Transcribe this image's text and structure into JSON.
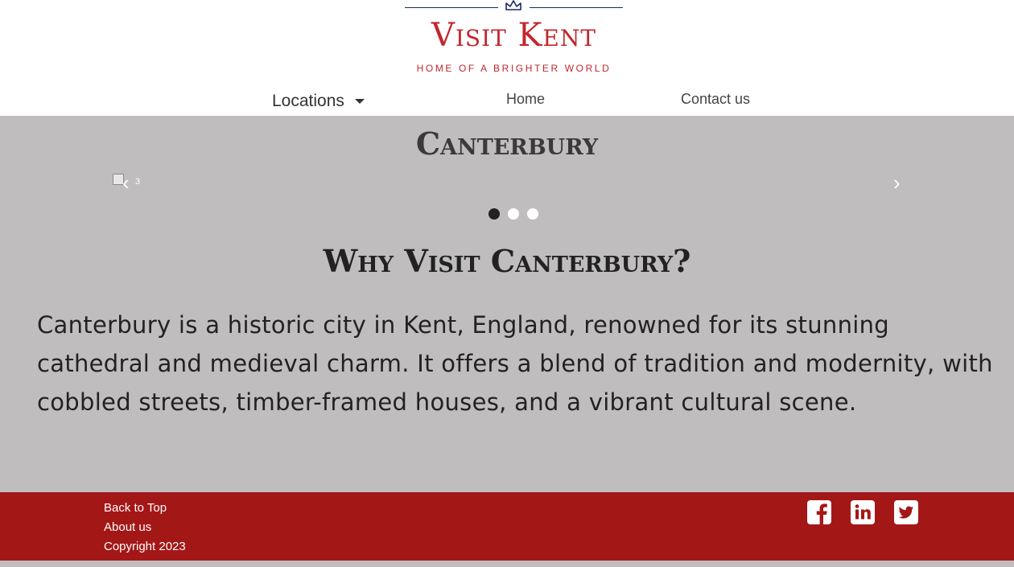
{
  "logo": {
    "title": "Visit Kent",
    "subtitle": "HOME OF A BRIGHTER WORLD",
    "icon": "crown-icon",
    "colors": {
      "text": "#c1272d",
      "line": "#1b2a5c"
    }
  },
  "nav": {
    "locations": "Locations",
    "home": "Home",
    "contact": "Contact us"
  },
  "page": {
    "heading": "Canterbury",
    "carousel": {
      "image_alt": "3",
      "prev": "‹",
      "next": "›",
      "dots": 3,
      "active_dot": 1
    },
    "section_heading": "Why Visit Canterbury?",
    "body": "Canterbury is a historic city in Kent, England, renowned for its stunning cathedral and medieval charm. It offers a blend of tradition and modernity, with cobbled streets, timber-framed houses, and a vibrant cultural scene."
  },
  "footer": {
    "links": [
      "Back to Top",
      "About us",
      "Copyright 2023"
    ],
    "socials": [
      "facebook-icon",
      "linkedin-icon",
      "twitter-icon"
    ],
    "background": "#a41717"
  },
  "colors": {
    "page_bg": "#bfbdbe",
    "header_bg": "#ffffff"
  }
}
